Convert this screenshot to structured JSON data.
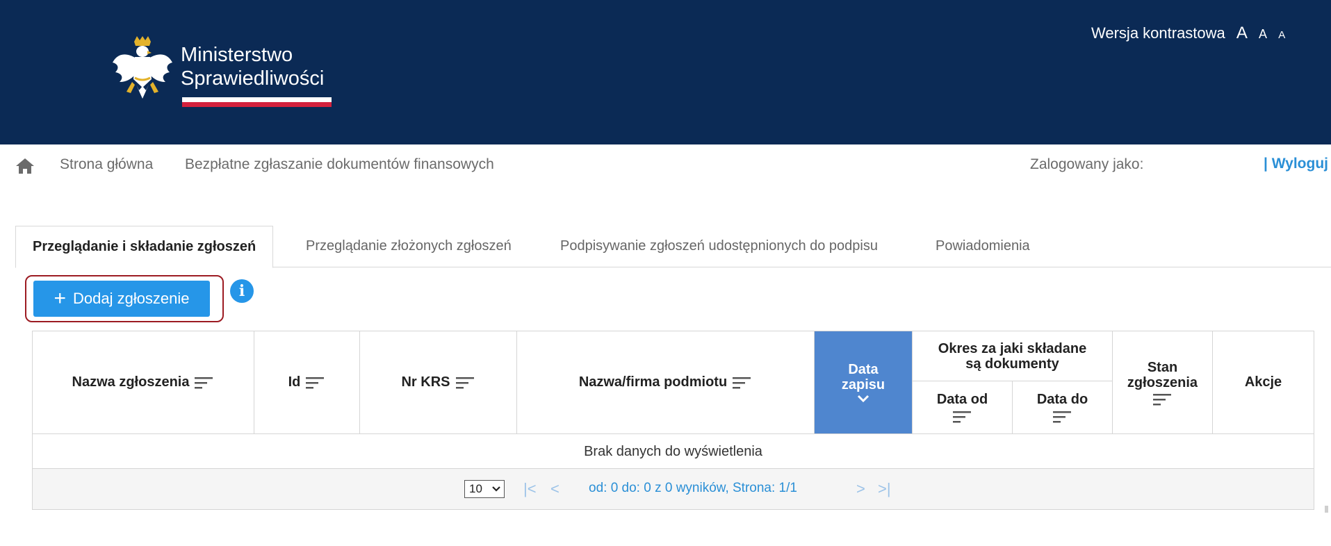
{
  "header": {
    "logo_line1": "Ministerstwo",
    "logo_line2": "Sprawiedliwości",
    "contrast_label": "Wersja kontrastowa",
    "font_a_large": "A",
    "font_a_medium": "A",
    "font_a_small": "A"
  },
  "breadcrumb": {
    "home_icon": "home-icon",
    "item1": "Strona główna",
    "item2": "Bezpłatne zgłaszanie dokumentów finansowych"
  },
  "user": {
    "logged_label": "Zalogowany jako:",
    "logout": "| Wyloguj"
  },
  "tabs": [
    {
      "label": "Przeglądanie i składanie zgłoszeń",
      "active": true
    },
    {
      "label": "Przeglądanie złożonych zgłoszeń",
      "active": false
    },
    {
      "label": "Podpisywanie zgłoszeń udostępnionych do podpisu",
      "active": false
    },
    {
      "label": "Powiadomienia",
      "active": false
    }
  ],
  "actions": {
    "add_label": "Dodaj zgłoszenie",
    "info_glyph": "i"
  },
  "table": {
    "columns": {
      "name": "Nazwa zgłoszenia",
      "id": "Id",
      "krs": "Nr KRS",
      "company": "Nazwa/firma podmiotu",
      "date_line1": "Data",
      "date_line2": "zapisu",
      "period_group": "Okres za jaki składane są dokumenty",
      "date_from": "Data od",
      "date_to": "Data do",
      "state_line1": "Stan",
      "state_line2": "zgłoszenia",
      "actions": "Akcje"
    },
    "empty_message": "Brak danych do wyświetlenia",
    "pager": {
      "page_size": "10",
      "first": "|<",
      "prev": "<",
      "next": ">",
      "last": ">|",
      "summary": "od: 0 do: 0 z 0 wyników, Strona: 1/1"
    }
  },
  "colors": {
    "header_bg": "#0b2a55",
    "accent": "#2696e8",
    "active_column": "#4f86cf",
    "highlight_border": "#9c1b22"
  }
}
